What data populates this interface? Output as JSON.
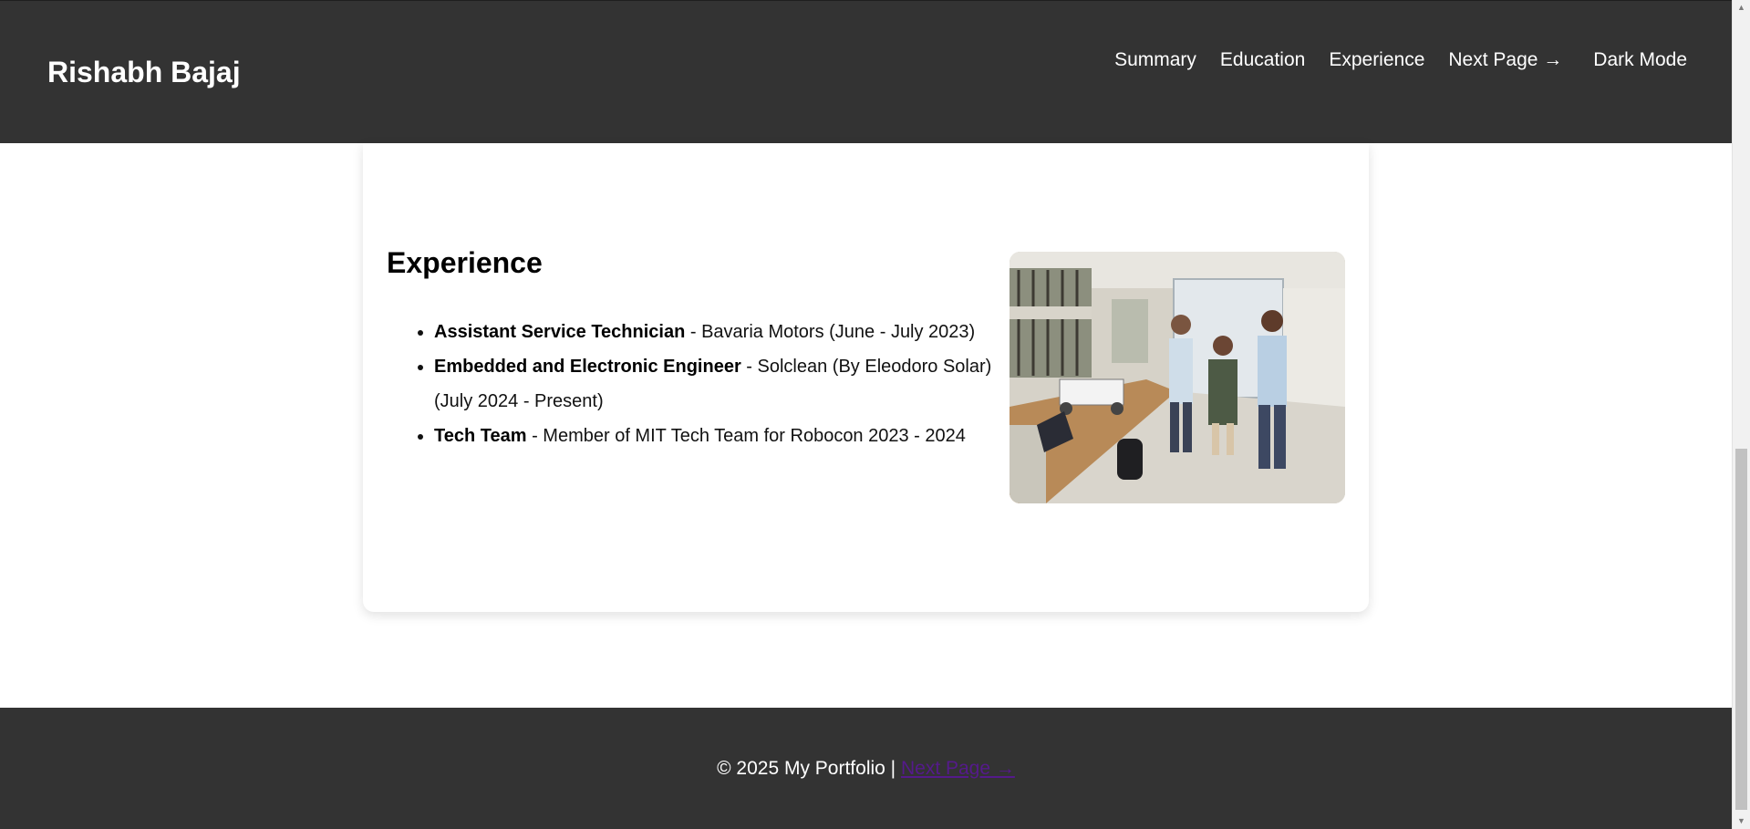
{
  "header": {
    "brand": "Rishabh Bajaj",
    "nav": [
      {
        "label": "Summary"
      },
      {
        "label": "Education"
      },
      {
        "label": "Experience"
      },
      {
        "label": "Next Page →"
      },
      {
        "label": "Dark Mode"
      }
    ]
  },
  "experience": {
    "title": "Experience",
    "items": [
      {
        "role": "Assistant Service Technician",
        "detail": " - Bavaria Motors (June - July 2023)"
      },
      {
        "role": "Embedded and Electronic Engineer",
        "detail": " - Solclean (By Eleodoro Solar) (July 2024 - Present)"
      },
      {
        "role": "Tech Team",
        "detail": " - Member of MIT Tech Team for Robocon 2023 - 2024"
      }
    ]
  },
  "footer": {
    "text": "© 2025 My Portfolio | ",
    "link": "Next Page →"
  },
  "colors": {
    "header_bg": "#333333",
    "footer_bg": "#333333",
    "page_bg": "#ffffff",
    "visited_link": "#551a8b"
  },
  "icons": {
    "scroll_up": "triangle-up-icon",
    "scroll_down": "triangle-down-icon"
  }
}
